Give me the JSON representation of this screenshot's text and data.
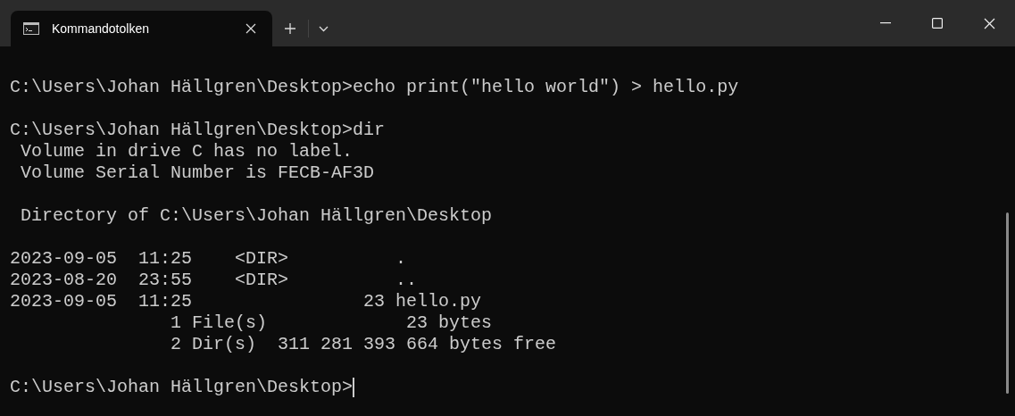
{
  "tabs": [
    {
      "title": "Kommandotolken",
      "selected": true
    }
  ],
  "terminal": {
    "blocks": [
      {
        "lines": [
          {
            "text": "C:\\Users\\Johan Hällgren\\Desktop>echo print(\"hello world\") > hello.py",
            "cursor": false
          }
        ]
      },
      {
        "lines": [
          {
            "text": "C:\\Users\\Johan Hällgren\\Desktop>dir",
            "cursor": false
          },
          {
            "text": " Volume in drive C has no label.",
            "cursor": false
          },
          {
            "text": " Volume Serial Number is FECB-AF3D",
            "cursor": false
          }
        ]
      },
      {
        "lines": [
          {
            "text": " Directory of C:\\Users\\Johan Hällgren\\Desktop",
            "cursor": false
          }
        ]
      },
      {
        "lines": [
          {
            "text": "2023-09-05  11:25    <DIR>          .",
            "cursor": false
          },
          {
            "text": "2023-08-20  23:55    <DIR>          ..",
            "cursor": false
          },
          {
            "text": "2023-09-05  11:25                23 hello.py",
            "cursor": false
          },
          {
            "text": "               1 File(s)             23 bytes",
            "cursor": false
          },
          {
            "text": "               2 Dir(s)  311 281 393 664 bytes free",
            "cursor": false
          }
        ]
      },
      {
        "lines": [
          {
            "text": "C:\\Users\\Johan Hällgren\\Desktop>",
            "cursor": true
          }
        ]
      }
    ]
  }
}
